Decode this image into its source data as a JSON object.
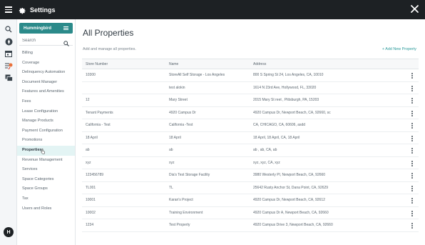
{
  "window": {
    "title": "Settings",
    "icons": [
      "menu-icon",
      "gear-icon",
      "close-icon"
    ]
  },
  "rail": {
    "icons": [
      "search-icon",
      "compass-icon",
      "calendar-icon",
      "tasks-icon",
      "messages-icon"
    ],
    "avatar_initial": "H"
  },
  "sidebar": {
    "facility": "Hummingbird",
    "search_placeholder": "Search",
    "active_item": "Properties",
    "items": [
      {
        "label": "Billing"
      },
      {
        "label": "Coverage"
      },
      {
        "label": "Delinquency Automation"
      },
      {
        "label": "Document Manager"
      },
      {
        "label": "Features and Amenities"
      },
      {
        "label": "Fees"
      },
      {
        "label": "Lease Configuration"
      },
      {
        "label": "Manage Products"
      },
      {
        "label": "Payment Configuration"
      },
      {
        "label": "Promotions"
      },
      {
        "label": "Properties"
      },
      {
        "label": "Revenue Management"
      },
      {
        "label": "Services"
      },
      {
        "label": "Space Categories"
      },
      {
        "label": "Space Groups"
      },
      {
        "label": "Tax"
      },
      {
        "label": "Users and Roles"
      }
    ]
  },
  "main": {
    "title": "All Properties",
    "subtitle": "Add and manage all properties.",
    "add_button": "+ Add New Property",
    "columns": [
      "Store Number",
      "Name",
      "Address"
    ],
    "rows": [
      {
        "store": "10300",
        "name": "StoreAll Self Storage - Los Angeles",
        "address": "800 S Spring St 24, Los Angeles, CA, 10010"
      },
      {
        "store": "",
        "name": "test alokin",
        "address": "1614 N 23rd Ave, Hollywood, FL, 33020"
      },
      {
        "store": "12",
        "name": "Mary Street",
        "address": "2015 Mary St reet , Pittsburgh, PA, 15203"
      },
      {
        "store": "Tenant Payments",
        "name": "4920 Campus Dr",
        "address": "4920 Campus Dr, Newport Beach, CA, 92660, sc"
      },
      {
        "store": "California - Test",
        "name": "California -Test",
        "address": "CA, CHICAGO, CA, 60606, asdd"
      },
      {
        "store": "18 April",
        "name": "18 April",
        "address": "18 April, 18 April, CA, 18 April"
      },
      {
        "store": "ab",
        "name": "ab",
        "address": "ab , ab, CA, ab"
      },
      {
        "store": "xyz",
        "name": "xyz",
        "address": "xyz, xyz, CA, xyz"
      },
      {
        "store": "123456789",
        "name": "Dia's Test Storage Facility",
        "address": "3980 Westerly Pl, Newport Beach, CA, 92660"
      },
      {
        "store": "TL001",
        "name": "TL",
        "address": "25642 Rusty Anchor St, Dana Point, CA, 92629"
      },
      {
        "store": "10001",
        "name": "Karan's Project",
        "address": "4920 Campus Dr, Newport Beach, CA, 92612"
      },
      {
        "store": "10002",
        "name": "Training Environment",
        "address": "4920 Campus Dr A, Newport Beach, CA, 92660"
      },
      {
        "store": "1234",
        "name": "Test Property",
        "address": "4920 Campus Drive 3, Newport Beach, CA, 92660"
      }
    ]
  },
  "colors": {
    "topbar": "#1d2124",
    "accent": "#2b8a8a",
    "link": "#2b9a9a",
    "active_bg": "#e3f4f4"
  }
}
